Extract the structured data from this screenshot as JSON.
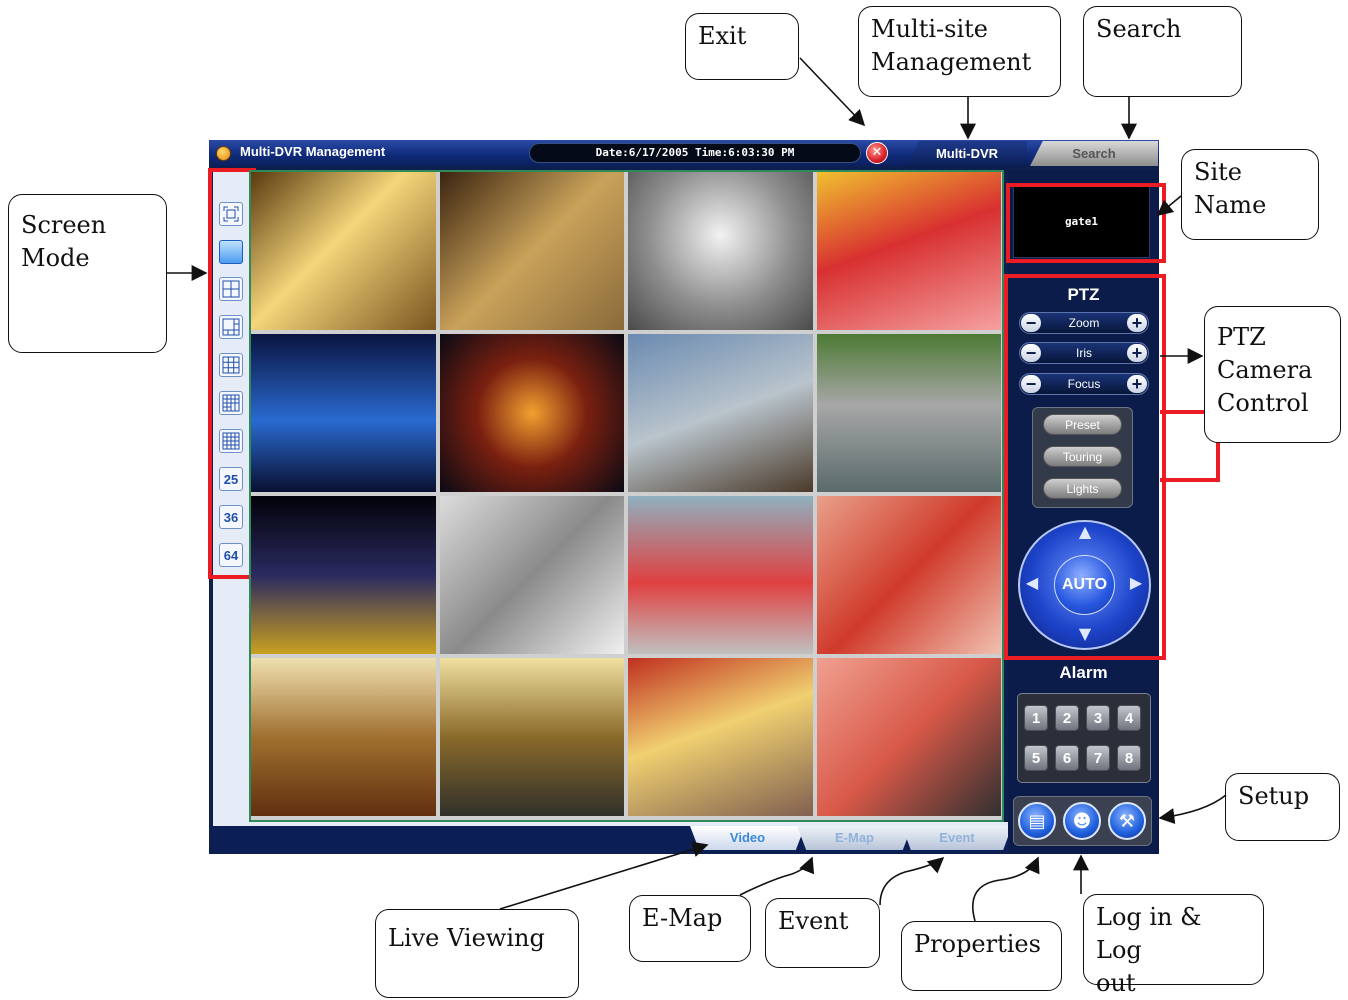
{
  "window": {
    "title": "Multi-DVR Management",
    "datetime": "Date:6/17/2005 Time:6:03:30 PM",
    "site_name": "gate1"
  },
  "top_tabs": [
    {
      "label": "Multi-DVR",
      "active": true
    },
    {
      "label": "Search",
      "active": false
    }
  ],
  "screen_modes": [
    "",
    "",
    "",
    "",
    "",
    "",
    "",
    "25",
    "36",
    "64"
  ],
  "bottom_tabs": [
    {
      "label": "Video",
      "active": true
    },
    {
      "label": "E-Map",
      "active": false
    },
    {
      "label": "Event",
      "active": false
    }
  ],
  "ptz": {
    "title": "PTZ",
    "controls": [
      "Zoom",
      "Iris",
      "Focus"
    ],
    "buttons": [
      "Preset",
      "Touring",
      "Lights"
    ],
    "auto": "AUTO"
  },
  "alarm": {
    "title": "Alarm",
    "buttons": [
      "1",
      "2",
      "3",
      "4",
      "5",
      "6",
      "7",
      "8"
    ]
  },
  "callouts": {
    "exit": "Exit",
    "multisite": "Multi-site\nManagement",
    "search": "Search",
    "screen_mode": "Screen\nMode",
    "site_name": "Site\nName",
    "ptz": "PTZ\nCamera\nControl",
    "setup": "Setup",
    "live": "Live Viewing",
    "emap": "E-Map",
    "event": "Event",
    "properties": "Properties",
    "login": "Log in & Log\nout"
  },
  "colors": {
    "highlight": "#ec1c24",
    "window_bg": "#0c1f4f"
  }
}
